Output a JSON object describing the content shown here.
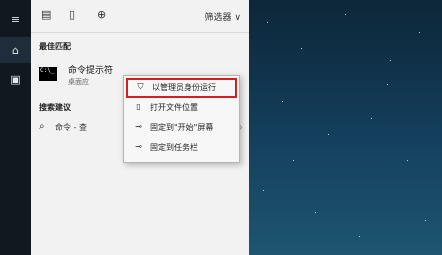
{
  "rail": {
    "items": [
      {
        "icon": "hamburger-menu-icon",
        "glyph": "≡"
      },
      {
        "icon": "home-icon",
        "glyph": "⌂"
      },
      {
        "icon": "contact-card-icon",
        "glyph": "▣"
      }
    ]
  },
  "topbar": {
    "filter_label": "筛选器",
    "filter_chevron": "∨"
  },
  "best_match": {
    "heading": "最佳匹配",
    "result": {
      "icon_glyph": "C:\\_",
      "title": "命令提示符",
      "subtitle": "桌面应"
    }
  },
  "search_suggestions": {
    "heading": "搜索建议",
    "item_text": "命令 - 查",
    "arrow": "›"
  },
  "context_menu": {
    "items": [
      {
        "icon": "shield-icon",
        "glyph": "⛉",
        "label": "以管理员身份运行"
      },
      {
        "icon": "open-folder-icon",
        "glyph": "▯",
        "label": "打开文件位置"
      },
      {
        "icon": "pin-icon",
        "glyph": "⊸",
        "label": "固定到\"开始\"屏幕"
      },
      {
        "icon": "pin-icon",
        "glyph": "⊸",
        "label": "固定到任务栏"
      }
    ]
  },
  "colors": {
    "highlight_border": "#d31f1f",
    "rail_background": "#101820"
  }
}
